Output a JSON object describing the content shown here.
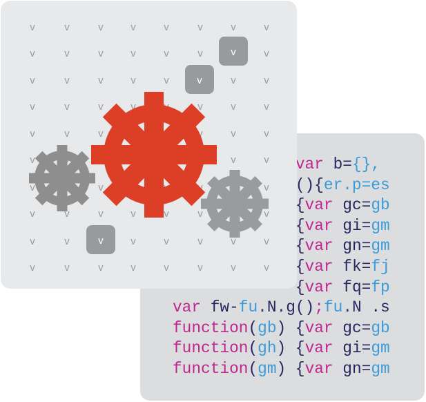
{
  "grid_letter": "v",
  "badge_letter": "v",
  "colors": {
    "code_panel_bg": "#dcdddf",
    "front_panel_bg": "#e8e9eb",
    "grid_letter": "#9a9b9e",
    "badge_bg": "#999a9e",
    "badge_text": "#ffffff",
    "gear_main": "#dc3e26",
    "gear_left": "#8e8e8e",
    "gear_right": "#9a9b9f",
    "keyword": "#c0268f",
    "identifier": "#2a2560",
    "value": "#3a9bd8"
  },
  "icons": [
    "gear-icon-large",
    "gear-icon-small-left",
    "gear-icon-small-right"
  ],
  "code_lines": [
    [
      [
        "             ",
        "identifier"
      ],
      [
        "var",
        "keyword"
      ],
      [
        " b=",
        "identifier"
      ],
      [
        "{},",
        "value"
      ]
    ],
    [
      [
        "             (){",
        "identifier"
      ],
      [
        "er.p=es",
        "value"
      ]
    ],
    [
      [
        "             {",
        "identifier"
      ],
      [
        "var",
        "keyword"
      ],
      [
        " gc=",
        "identifier"
      ],
      [
        "gb",
        "value"
      ]
    ],
    [
      [
        "             {",
        "identifier"
      ],
      [
        "var",
        "keyword"
      ],
      [
        " gi=",
        "identifier"
      ],
      [
        "gm",
        "value"
      ]
    ],
    [
      [
        "             {",
        "identifier"
      ],
      [
        "var",
        "keyword"
      ],
      [
        " gn=",
        "identifier"
      ],
      [
        "gm",
        "value"
      ]
    ],
    [
      [
        "             {",
        "identifier"
      ],
      [
        "var",
        "keyword"
      ],
      [
        " fk=",
        "identifier"
      ],
      [
        "fj",
        "value"
      ]
    ],
    [
      [
        "             {",
        "identifier"
      ],
      [
        "var",
        "keyword"
      ],
      [
        " fq=",
        "identifier"
      ],
      [
        "fp",
        "value"
      ]
    ],
    [
      [
        "var",
        "keyword"
      ],
      [
        " fw-",
        "identifier"
      ],
      [
        "fu",
        "value"
      ],
      [
        ".N.g()",
        "identifier"
      ],
      [
        ";",
        "keyword"
      ],
      [
        "fu",
        "value"
      ],
      [
        ".N .s",
        "identifier"
      ]
    ],
    [
      [
        "function",
        "keyword"
      ],
      [
        "(",
        "identifier"
      ],
      [
        "gb",
        "value"
      ],
      [
        ") {",
        "identifier"
      ],
      [
        "var",
        "keyword"
      ],
      [
        " gc=",
        "identifier"
      ],
      [
        "gb",
        "value"
      ]
    ],
    [
      [
        "function",
        "keyword"
      ],
      [
        "(",
        "identifier"
      ],
      [
        "gh",
        "value"
      ],
      [
        ") {",
        "identifier"
      ],
      [
        "var",
        "keyword"
      ],
      [
        " gi=",
        "identifier"
      ],
      [
        "gm",
        "value"
      ]
    ],
    [
      [
        "function",
        "keyword"
      ],
      [
        "(",
        "identifier"
      ],
      [
        "gm",
        "value"
      ],
      [
        ") {",
        "identifier"
      ],
      [
        "var",
        "keyword"
      ],
      [
        " gn=",
        "identifier"
      ],
      [
        "gm",
        "value"
      ]
    ]
  ]
}
